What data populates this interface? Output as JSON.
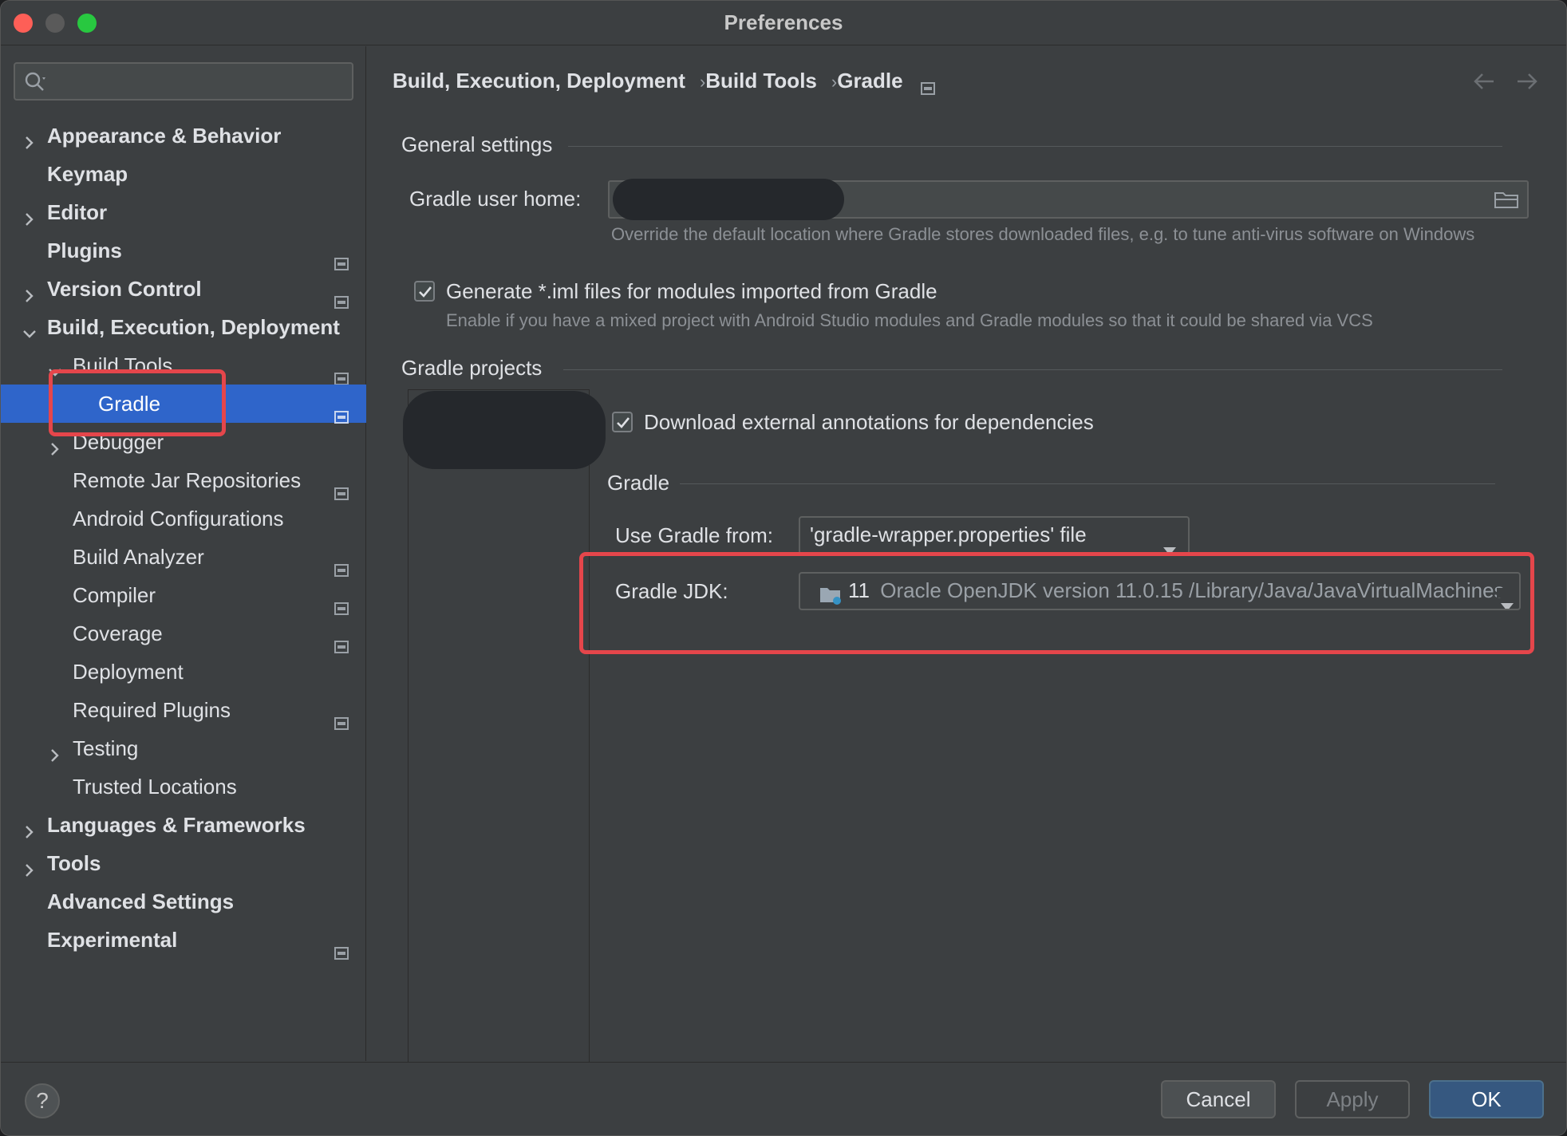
{
  "window": {
    "title": "Preferences"
  },
  "search": {
    "placeholder": ""
  },
  "sidebar": {
    "items": [
      {
        "label": "Appearance & Behavior",
        "level": 0,
        "expander": "collapsed",
        "bold": true,
        "project": false
      },
      {
        "label": "Keymap",
        "level": 0,
        "expander": "none",
        "bold": true,
        "project": false
      },
      {
        "label": "Editor",
        "level": 0,
        "expander": "collapsed",
        "bold": true,
        "project": false
      },
      {
        "label": "Plugins",
        "level": 0,
        "expander": "none",
        "bold": true,
        "project": true
      },
      {
        "label": "Version Control",
        "level": 0,
        "expander": "collapsed",
        "bold": true,
        "project": true
      },
      {
        "label": "Build, Execution, Deployment",
        "level": 0,
        "expander": "expanded",
        "bold": true,
        "project": false
      },
      {
        "label": "Build Tools",
        "level": 1,
        "expander": "expanded",
        "bold": false,
        "project": true
      },
      {
        "label": "Gradle",
        "level": 2,
        "expander": "none",
        "bold": false,
        "project": true,
        "selected": true
      },
      {
        "label": "Debugger",
        "level": 1,
        "expander": "collapsed",
        "bold": false,
        "project": false
      },
      {
        "label": "Remote Jar Repositories",
        "level": 1,
        "expander": "none",
        "bold": false,
        "project": true
      },
      {
        "label": "Android Configurations",
        "level": 1,
        "expander": "none",
        "bold": false,
        "project": false
      },
      {
        "label": "Build Analyzer",
        "level": 1,
        "expander": "none",
        "bold": false,
        "project": true
      },
      {
        "label": "Compiler",
        "level": 1,
        "expander": "none",
        "bold": false,
        "project": true
      },
      {
        "label": "Coverage",
        "level": 1,
        "expander": "none",
        "bold": false,
        "project": true
      },
      {
        "label": "Deployment",
        "level": 1,
        "expander": "none",
        "bold": false,
        "project": false
      },
      {
        "label": "Required Plugins",
        "level": 1,
        "expander": "none",
        "bold": false,
        "project": true
      },
      {
        "label": "Testing",
        "level": 1,
        "expander": "collapsed",
        "bold": false,
        "project": false
      },
      {
        "label": "Trusted Locations",
        "level": 1,
        "expander": "none",
        "bold": false,
        "project": false
      },
      {
        "label": "Languages & Frameworks",
        "level": 0,
        "expander": "collapsed",
        "bold": true,
        "project": false
      },
      {
        "label": "Tools",
        "level": 0,
        "expander": "collapsed",
        "bold": true,
        "project": false
      },
      {
        "label": "Advanced Settings",
        "level": 0,
        "expander": "none",
        "bold": true,
        "project": false
      },
      {
        "label": "Experimental",
        "level": 0,
        "expander": "none",
        "bold": true,
        "project": true
      }
    ]
  },
  "breadcrumb": {
    "items": [
      "Build, Execution, Deployment",
      "Build Tools",
      "Gradle"
    ],
    "separator": "›"
  },
  "general": {
    "title": "General settings",
    "user_home_label": "Gradle user home:",
    "user_home_value": "",
    "user_home_hint": "Override the default location where Gradle stores downloaded files, e.g. to tune anti-virus software on Windows",
    "generate_iml_label": "Generate *.iml files for modules imported from Gradle",
    "generate_iml_checked": true,
    "generate_iml_hint": "Enable if you have a mixed project with Android Studio modules and Gradle modules so that it could be shared via VCS"
  },
  "projects": {
    "title": "Gradle projects",
    "download_annotations_label": "Download external annotations for dependencies",
    "download_annotations_checked": true,
    "gradle_section_title": "Gradle",
    "use_gradle_from_label": "Use Gradle from:",
    "use_gradle_from_value": "'gradle-wrapper.properties' file",
    "jdk_label": "Gradle JDK:",
    "jdk_version": "11",
    "jdk_detail": "Oracle OpenJDK version 11.0.15 /Library/Java/JavaVirtualMachines"
  },
  "footer": {
    "help_label": "?",
    "cancel_label": "Cancel",
    "apply_label": "Apply",
    "ok_label": "OK"
  },
  "colors": {
    "accent": "#2f65ca",
    "highlight": "#e5464b",
    "background": "#3c3f41"
  }
}
